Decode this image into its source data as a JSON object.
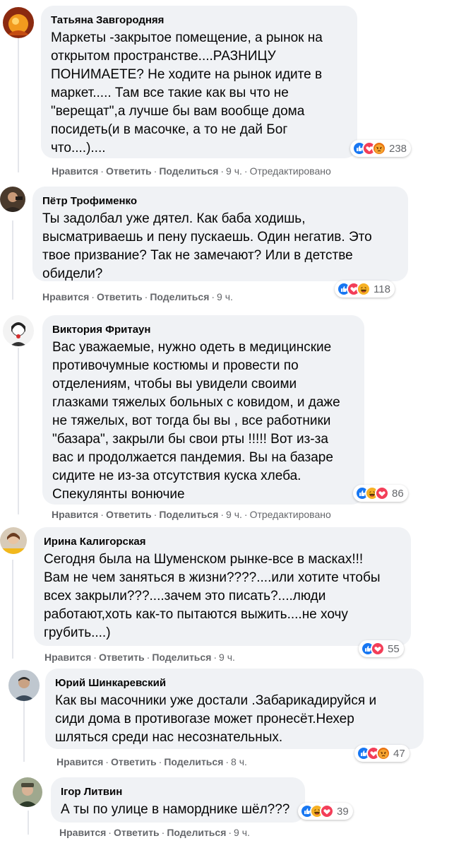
{
  "comments": [
    {
      "author": "Татьяна Завгородняя",
      "text": "Маркеты -закрытое помещение, а рынок на\nоткрытом пространстве....РАЗНИЦУ\nПОНИМАЕТЕ? Не ходите на рынок идите в\nмаркет..... Там все такие как вы что не\n\"верещат\",а лучше бы вам вообще дома\nпосидеть(и в масочке, а то не дай Бог\nчто....)....",
      "reactions": [
        "like",
        "love",
        "angry"
      ],
      "reaction_count": "238",
      "like_label": "Нравится",
      "reply_label": "Ответить",
      "share_label": "Поделиться",
      "time": "9 ч.",
      "edited": "Отредактировано"
    },
    {
      "author": "Пётр Трофименко",
      "text": "Ты задолбал уже дятел. Как баба ходишь,\nвысматриваешь и пену пускаешь. Один негатив. Это\nтвое призвание? Так не замечают? Или в детстве\nобидели?",
      "reactions": [
        "like",
        "love",
        "haha"
      ],
      "reaction_count": "118",
      "like_label": "Нравится",
      "reply_label": "Ответить",
      "share_label": "Поделиться",
      "time": "9 ч.",
      "edited": ""
    },
    {
      "author": "Виктория Фритаун",
      "text": "Вас уважаемые, нужно одеть в медицинские\nпротивочумные костюмы и провести по\nотделениям, чтобы вы увидели своими\nглазками тяжелых больных с ковидом, и даже\nне тяжелых, вот тогда бы вы , все работники\n\"базара\", закрыли бы свои рты !!!!! Вот из-за\nвас и продолжается пандемия. Вы на базаре\nсидите не из-за отсутствия куска хлеба.\nСпекулянты вонючие",
      "reactions": [
        "like",
        "haha",
        "love"
      ],
      "reaction_count": "86",
      "like_label": "Нравится",
      "reply_label": "Ответить",
      "share_label": "Поделиться",
      "time": "9 ч.",
      "edited": "Отредактировано"
    },
    {
      "author": "Ирина Калигорская",
      "text": "Сегодня была на Шуменском рынке-все в масках!!!\nВам не чем заняться в жизни????....или хотите чтобы\nвсех закрыли???....зачем это писать?....люди\nработают,хоть как-то пытаются выжить....не хочу\nгрубить....)",
      "reactions": [
        "like",
        "love"
      ],
      "reaction_count": "55",
      "like_label": "Нравится",
      "reply_label": "Ответить",
      "share_label": "Поделиться",
      "time": "9 ч.",
      "edited": ""
    },
    {
      "author": "Юрий Шинкаревский",
      "text": "Как вы масочники уже достали .Забарикадируйся и\nсиди дома в противогазе может пронесёт.Нехер\nшляться среди нас несознательных.",
      "reactions": [
        "like",
        "love",
        "angry"
      ],
      "reaction_count": "47",
      "like_label": "Нравится",
      "reply_label": "Ответить",
      "share_label": "Поделиться",
      "time": "8 ч.",
      "edited": ""
    },
    {
      "author": "Ігор Литвин",
      "text": "А ты по улице в наморднике шёл???",
      "reactions": [
        "like",
        "haha",
        "love"
      ],
      "reaction_count": "39",
      "like_label": "Нравится",
      "reply_label": "Ответить",
      "share_label": "Поделиться",
      "time": "9 ч.",
      "edited": ""
    }
  ],
  "colors": {
    "bubble": "#f0f2f5",
    "meta_text": "#65676b",
    "like": "#1877f2",
    "love": "#f33e58",
    "haha": "#f7b125",
    "angry": "#e9710f"
  }
}
